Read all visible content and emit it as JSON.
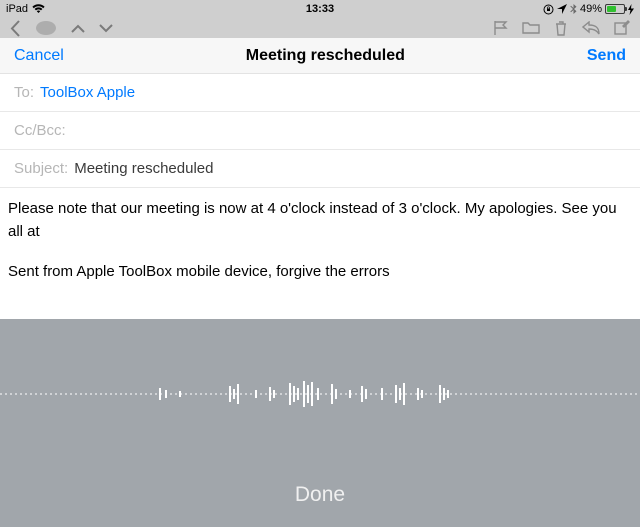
{
  "status": {
    "device": "iPad",
    "time": "13:33",
    "battery_percent": "49%"
  },
  "compose": {
    "cancel": "Cancel",
    "title": "Meeting rescheduled",
    "send": "Send"
  },
  "fields": {
    "to_label": "To:",
    "to_value": "ToolBox Apple",
    "ccbcc_label": "Cc/Bcc:",
    "subject_label": "Subject:",
    "subject_value": "Meeting rescheduled"
  },
  "body": {
    "text": "Please note that our meeting is now at 4 o'clock instead of 3 o'clock. My apologies. See you all at",
    "signature": "Sent from Apple ToolBox mobile device, forgive the errors"
  },
  "dictation": {
    "done": "Done"
  }
}
